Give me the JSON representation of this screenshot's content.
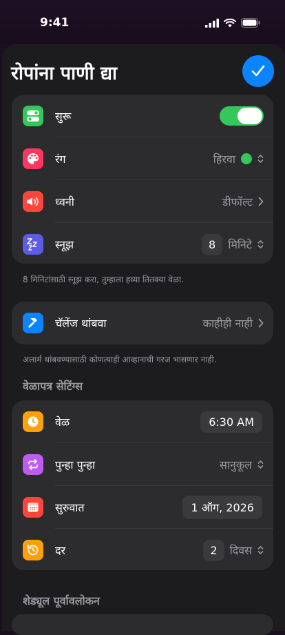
{
  "status": {
    "time": "9:41"
  },
  "header": {
    "title": "रोपांना पाणी द्या"
  },
  "main_card": {
    "rows": [
      {
        "label": "सुरू",
        "toggle_on": true,
        "icon": "toggle-icon",
        "color": "#34c759"
      },
      {
        "label": "रंग",
        "value": "हिरवा",
        "swatch": "#34c759",
        "icon": "palette-icon",
        "color": "#ff375f"
      },
      {
        "label": "ध्वनी",
        "value": "डीफॉल्ट",
        "icon": "speaker-icon",
        "color": "#ff453a"
      },
      {
        "label": "स्नूझ",
        "number": "8",
        "unit": "मिनिटे",
        "icon": "zzz-icon",
        "color": "#5e5ce6"
      }
    ]
  },
  "snooze_note": "8 मिनिटांसाठी स्नूझ करा, तुम्हाला हव्या तितक्या वेळा.",
  "challenge_card": {
    "label": "चॅलेंज थांबवा",
    "value": "काहीही नाही",
    "icon": "hammer-icon",
    "color": "#0a84ff"
  },
  "challenge_note": "अलार्म थांबवण्यासाठी कोणत्याही आव्हानाची गरज भासणार नाही.",
  "schedule": {
    "header": "वेळापत्र सेटिंग्स",
    "rows": [
      {
        "label": "वेळ",
        "value": "6:30 AM",
        "icon": "clock-icon",
        "color": "#ff9f0a"
      },
      {
        "label": "पुन्हा पुन्हा",
        "value": "सानुकूल",
        "icon": "repeat-icon",
        "color": "#bf5af2"
      },
      {
        "label": "सुरुवात",
        "value": "1 ऑग, 2026",
        "icon": "calendar-icon",
        "color": "#ff453a"
      },
      {
        "label": "दर",
        "number": "2",
        "unit": "दिवस",
        "icon": "history-icon",
        "color": "#ff9f0a"
      }
    ]
  },
  "preview": {
    "header": "शेड्यूल पूर्वावलोकन"
  }
}
